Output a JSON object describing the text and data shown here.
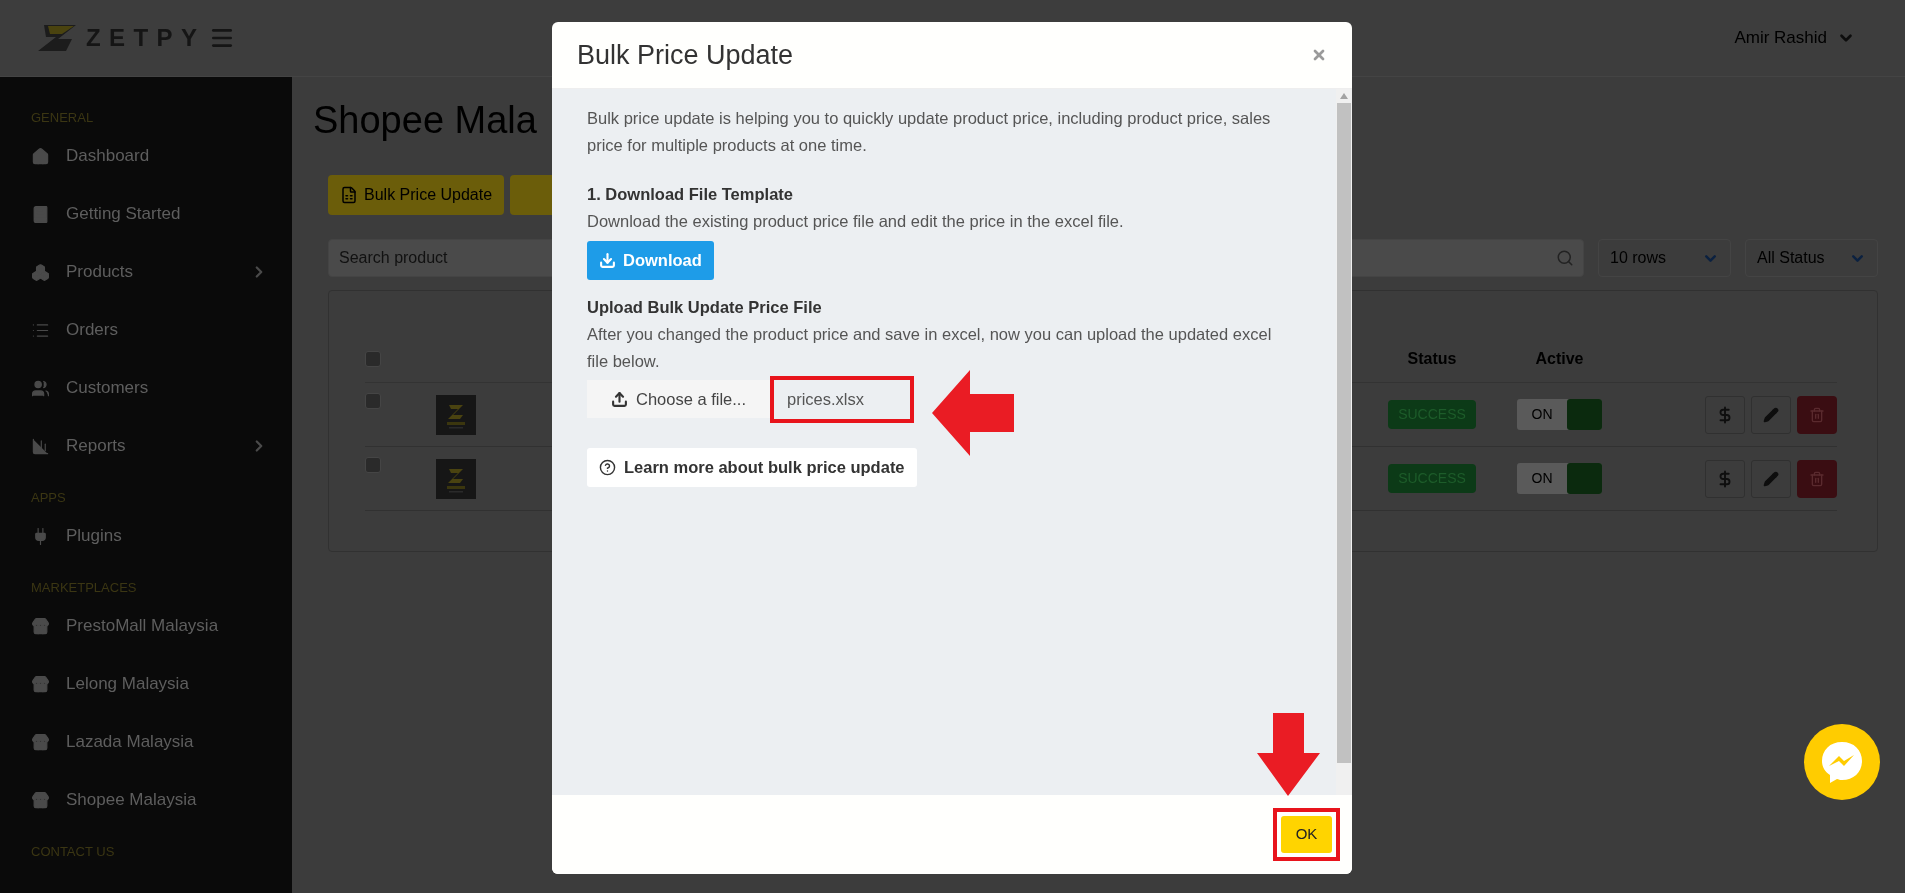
{
  "header": {
    "logo": "ZETPY",
    "user": "Amir Rashid"
  },
  "sidebar": {
    "sections": [
      {
        "label": "GENERAL",
        "items": [
          {
            "label": "Dashboard",
            "kind": "home",
            "has_submenu": false
          },
          {
            "label": "Getting Started",
            "kind": "book",
            "has_submenu": false
          },
          {
            "label": "Products",
            "kind": "boxes",
            "has_submenu": true
          },
          {
            "label": "Orders",
            "kind": "list",
            "has_submenu": false
          },
          {
            "label": "Customers",
            "kind": "users",
            "has_submenu": false
          },
          {
            "label": "Reports",
            "kind": "chart",
            "has_submenu": true
          }
        ]
      },
      {
        "label": "APPS",
        "items": [
          {
            "label": "Plugins",
            "kind": "plug",
            "has_submenu": false
          }
        ]
      },
      {
        "label": "MARKETPLACES",
        "items": [
          {
            "label": "PrestoMall Malaysia",
            "kind": "store",
            "has_submenu": false
          },
          {
            "label": "Lelong Malaysia",
            "kind": "store",
            "has_submenu": false
          },
          {
            "label": "Lazada Malaysia",
            "kind": "store",
            "has_submenu": false
          },
          {
            "label": "Shopee Malaysia",
            "kind": "store",
            "has_submenu": false
          }
        ]
      },
      {
        "label": "CONTACT US"
      }
    ]
  },
  "page": {
    "title": "Shopee Mala",
    "bulk_button": "Bulk Price Update",
    "search": {
      "placeholder": "Search product"
    },
    "rows_select": "10 rows",
    "status_select": "All Status",
    "table": {
      "columns": [
        "Status",
        "Active"
      ],
      "header_checked": false,
      "rows": [
        {
          "checked": false,
          "status": "SUCCESS",
          "active": true,
          "toggle_label": "ON"
        },
        {
          "checked": false,
          "status": "SUCCESS",
          "active": true,
          "toggle_label": "ON"
        }
      ]
    }
  },
  "modal": {
    "title": "Bulk Price Update",
    "intro": "Bulk price update is helping you to quickly update product price, including product price, sales price for multiple products at one time.",
    "step1_title": "1. Download File Template",
    "step1_text": "Download the existing product price file and edit the price in the excel file.",
    "download_button": "Download",
    "upload_title": "Upload Bulk Update Price File",
    "upload_text": "After you changed the product price and save in excel, now you can upload the updated excel file below.",
    "choose_button": "Choose a file...",
    "file_name": "prices.xlsx",
    "help_button": "Learn more about bulk price update",
    "ok_button": "OK"
  }
}
